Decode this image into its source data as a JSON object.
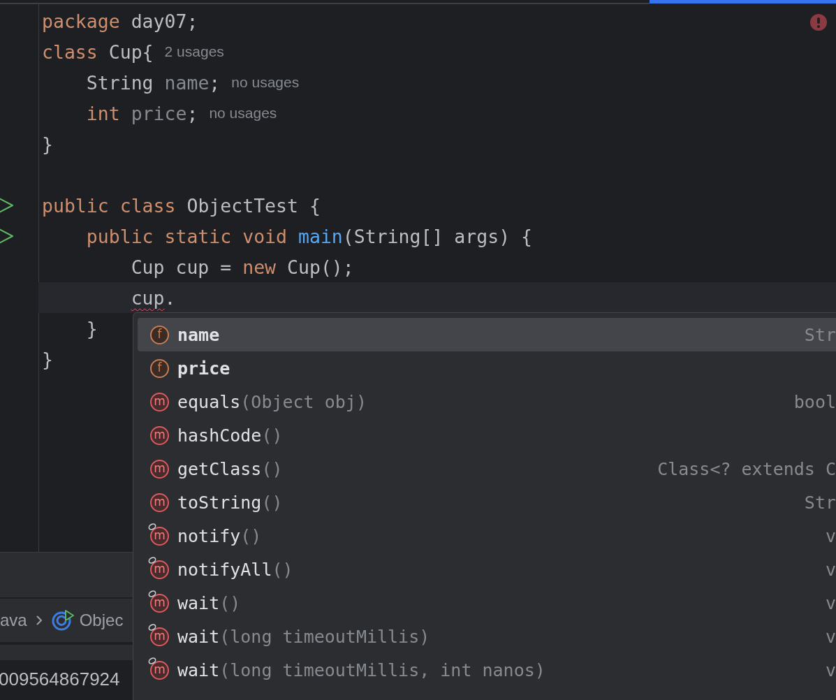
{
  "editor": {
    "error_indicator": true,
    "lines": [
      {
        "kind": "code",
        "tokens": [
          {
            "text": "package",
            "kind": "keyword"
          },
          {
            "text": " day07;",
            "kind": "plain"
          }
        ]
      },
      {
        "kind": "code",
        "tokens": [
          {
            "text": "class",
            "kind": "keyword"
          },
          {
            "text": " Cup{",
            "kind": "plain"
          }
        ],
        "hint": "2 usages"
      },
      {
        "kind": "code",
        "tokens": [
          {
            "text": "    String ",
            "kind": "plain"
          },
          {
            "text": "name",
            "kind": "unused"
          },
          {
            "text": ";",
            "kind": "plain"
          }
        ],
        "hint": "no usages"
      },
      {
        "kind": "code",
        "tokens": [
          {
            "text": "    int",
            "kind": "keyword"
          },
          {
            "text": " price",
            "kind": "unused"
          },
          {
            "text": ";",
            "kind": "plain"
          }
        ],
        "hint": "no usages"
      },
      {
        "kind": "code",
        "tokens": [
          {
            "text": "}",
            "kind": "plain"
          }
        ]
      },
      {
        "kind": "blank"
      },
      {
        "kind": "code",
        "run": true,
        "tokens": [
          {
            "text": "public class",
            "kind": "keyword"
          },
          {
            "text": " ObjectTest {",
            "kind": "plain"
          }
        ]
      },
      {
        "kind": "code",
        "run": true,
        "tokens": [
          {
            "text": "    public static void ",
            "kind": "keyword"
          },
          {
            "text": "main",
            "kind": "method"
          },
          {
            "text": "(String[] args) {",
            "kind": "plain"
          }
        ]
      },
      {
        "kind": "code",
        "tokens": [
          {
            "text": "        Cup cup = ",
            "kind": "plain"
          },
          {
            "text": "new",
            "kind": "keyword"
          },
          {
            "text": " Cup();",
            "kind": "plain"
          }
        ]
      },
      {
        "kind": "code",
        "current": true,
        "tokens": [
          {
            "text": "        cup",
            "kind": "plain",
            "error": true
          },
          {
            "text": ".",
            "kind": "plain"
          }
        ]
      },
      {
        "kind": "code",
        "tokens": [
          {
            "text": "    }",
            "kind": "plain"
          }
        ]
      },
      {
        "kind": "code",
        "tokens": [
          {
            "text": "}",
            "kind": "plain"
          }
        ]
      }
    ]
  },
  "breadcrumb": {
    "items": [
      "ava",
      "Objec"
    ]
  },
  "console": {
    "text": "009564867924"
  },
  "completion": {
    "items": [
      {
        "kind": "field",
        "badge": "f",
        "name": "name",
        "type": "Str",
        "selected": true,
        "overlay": false
      },
      {
        "kind": "field",
        "badge": "f",
        "name": "price",
        "selected": false,
        "overlay": false
      },
      {
        "kind": "method",
        "badge": "m",
        "name": "equals",
        "params": "(Object obj)",
        "type": "bool",
        "selected": false,
        "overlay": false
      },
      {
        "kind": "method",
        "badge": "m",
        "name": "hashCode",
        "params": "()",
        "selected": false,
        "overlay": false
      },
      {
        "kind": "method",
        "badge": "m",
        "name": "getClass",
        "params": "()",
        "type": "Class<? extends C",
        "selected": false,
        "overlay": false
      },
      {
        "kind": "method",
        "badge": "m",
        "name": "toString",
        "params": "()",
        "type": "Str",
        "selected": false,
        "overlay": false
      },
      {
        "kind": "method",
        "badge": "m",
        "name": "notify",
        "params": "()",
        "type": "v",
        "selected": false,
        "overlay": true
      },
      {
        "kind": "method",
        "badge": "m",
        "name": "notifyAll",
        "params": "()",
        "type": "v",
        "selected": false,
        "overlay": true
      },
      {
        "kind": "method",
        "badge": "m",
        "name": "wait",
        "params": "()",
        "type": "v",
        "selected": false,
        "overlay": true
      },
      {
        "kind": "method",
        "badge": "m",
        "name": "wait",
        "params": "(long timeoutMillis)",
        "type": "v",
        "selected": false,
        "overlay": true
      },
      {
        "kind": "method",
        "badge": "m",
        "name": "wait",
        "params": "(long timeoutMillis, int nanos)",
        "type": "v",
        "selected": false,
        "overlay": true
      }
    ]
  }
}
